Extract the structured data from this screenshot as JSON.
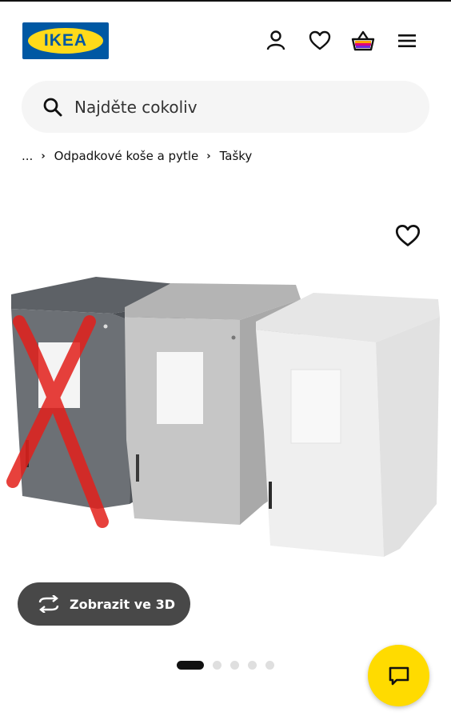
{
  "header": {
    "logo_text": "IKEA",
    "icons": [
      "user-icon",
      "heart-icon",
      "basket-icon",
      "menu-icon"
    ]
  },
  "search": {
    "placeholder": "Najděte cokoliv",
    "icon": "search-icon"
  },
  "breadcrumb": {
    "ellipsis": "...",
    "items": [
      "Odpadkové koše a pytle",
      "Tašky"
    ]
  },
  "product": {
    "favourite_icon": "heart-outline-icon",
    "image_alt": "",
    "view_3d_label": "Zobrazit ve 3D",
    "view_3d_icon": "rotate-icon"
  },
  "carousel": {
    "count": 5,
    "active_index": 0
  },
  "chat": {
    "icon": "chat-icon"
  },
  "colors": {
    "brand_blue": "#0058a3",
    "brand_yellow": "#ffda1a",
    "chat_yellow": "#ffdb00",
    "button_dark": "#484848"
  }
}
